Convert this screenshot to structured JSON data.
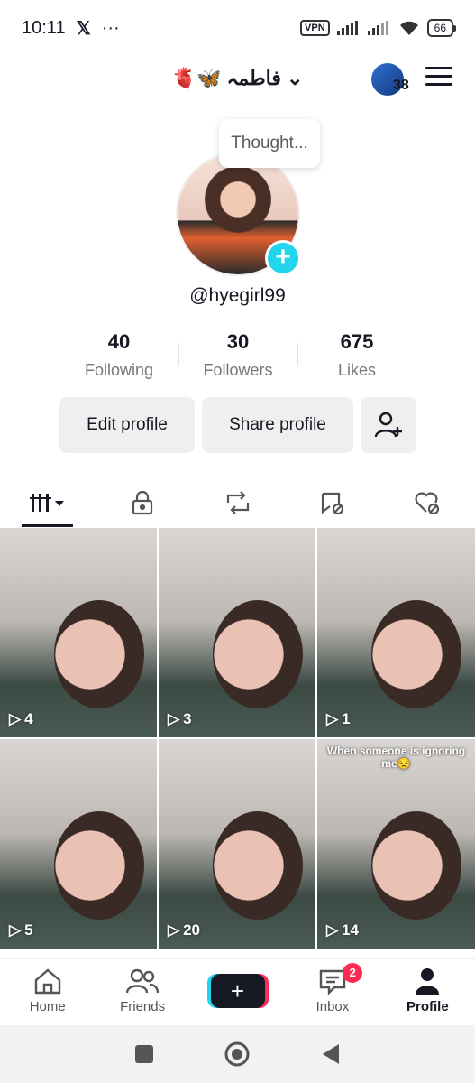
{
  "status_bar": {
    "time": "10:11",
    "vpn": "VPN",
    "battery": "66"
  },
  "header": {
    "display_name": "🫀🦋 فاطمہ",
    "follower_badge_count": "38"
  },
  "profile": {
    "thought_bubble": "Thought...",
    "username": "@hyegirl99"
  },
  "stats": [
    {
      "value": "40",
      "label": "Following"
    },
    {
      "value": "30",
      "label": "Followers"
    },
    {
      "value": "675",
      "label": "Likes"
    }
  ],
  "actions": {
    "edit": "Edit profile",
    "share": "Share profile"
  },
  "videos": [
    {
      "plays": "4",
      "caption": ""
    },
    {
      "plays": "3",
      "caption": ""
    },
    {
      "plays": "1",
      "caption": ""
    },
    {
      "plays": "5",
      "caption": ""
    },
    {
      "plays": "20",
      "caption": ""
    },
    {
      "plays": "14",
      "caption": "When someone is ignoring me😒"
    }
  ],
  "bottom_nav": {
    "home": "Home",
    "friends": "Friends",
    "inbox": "Inbox",
    "inbox_badge": "2",
    "profile": "Profile"
  }
}
